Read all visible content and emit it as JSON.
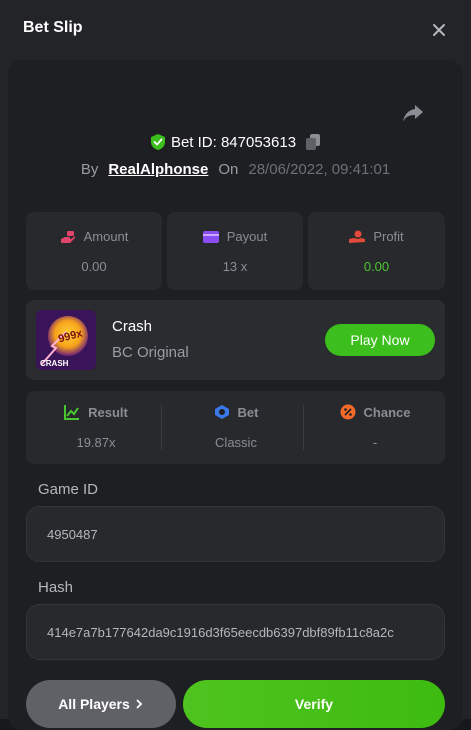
{
  "header": {
    "title": "Bet Slip",
    "close_icon": "close-icon"
  },
  "bet": {
    "id_label": "Bet ID: 847053613",
    "by_label": "By",
    "user": "RealAlphonse",
    "on_label": "On",
    "date": "28/06/2022, 09:41:01"
  },
  "stats": [
    {
      "label": "Amount",
      "value": "0.00",
      "icon": "money-hand-icon",
      "color": "#e0456b"
    },
    {
      "label": "Payout",
      "value": "13 x",
      "icon": "wallet-icon",
      "color": "#8a4df0"
    },
    {
      "label": "Profit",
      "value": "0.00",
      "icon": "hand-coin-icon",
      "color": "#e34a3b"
    }
  ],
  "game": {
    "name": "Crash",
    "provider": "BC Original",
    "play_label": "Play Now",
    "thumb_text": "999x",
    "thumb_label": "CRASH"
  },
  "result": [
    {
      "label": "Result",
      "value": "19.87x",
      "icon": "chart-icon",
      "color": "#49c72e"
    },
    {
      "label": "Bet",
      "value": "Classic",
      "icon": "chip-icon",
      "color": "#3a78e8"
    },
    {
      "label": "Chance",
      "value": "-",
      "icon": "percent-icon",
      "color": "#f06b2a"
    }
  ],
  "fields": {
    "game_id_label": "Game ID",
    "game_id_value": "4950487",
    "hash_label": "Hash",
    "hash_value": "414e7a7b177642da9c1916d3f65eecdb6397dbf89fb11c8a2c"
  },
  "actions": {
    "players_label": "All Players",
    "verify_label": "Verify"
  },
  "colors": {
    "accent": "#3cbe1c",
    "background": "#1e1f22"
  }
}
